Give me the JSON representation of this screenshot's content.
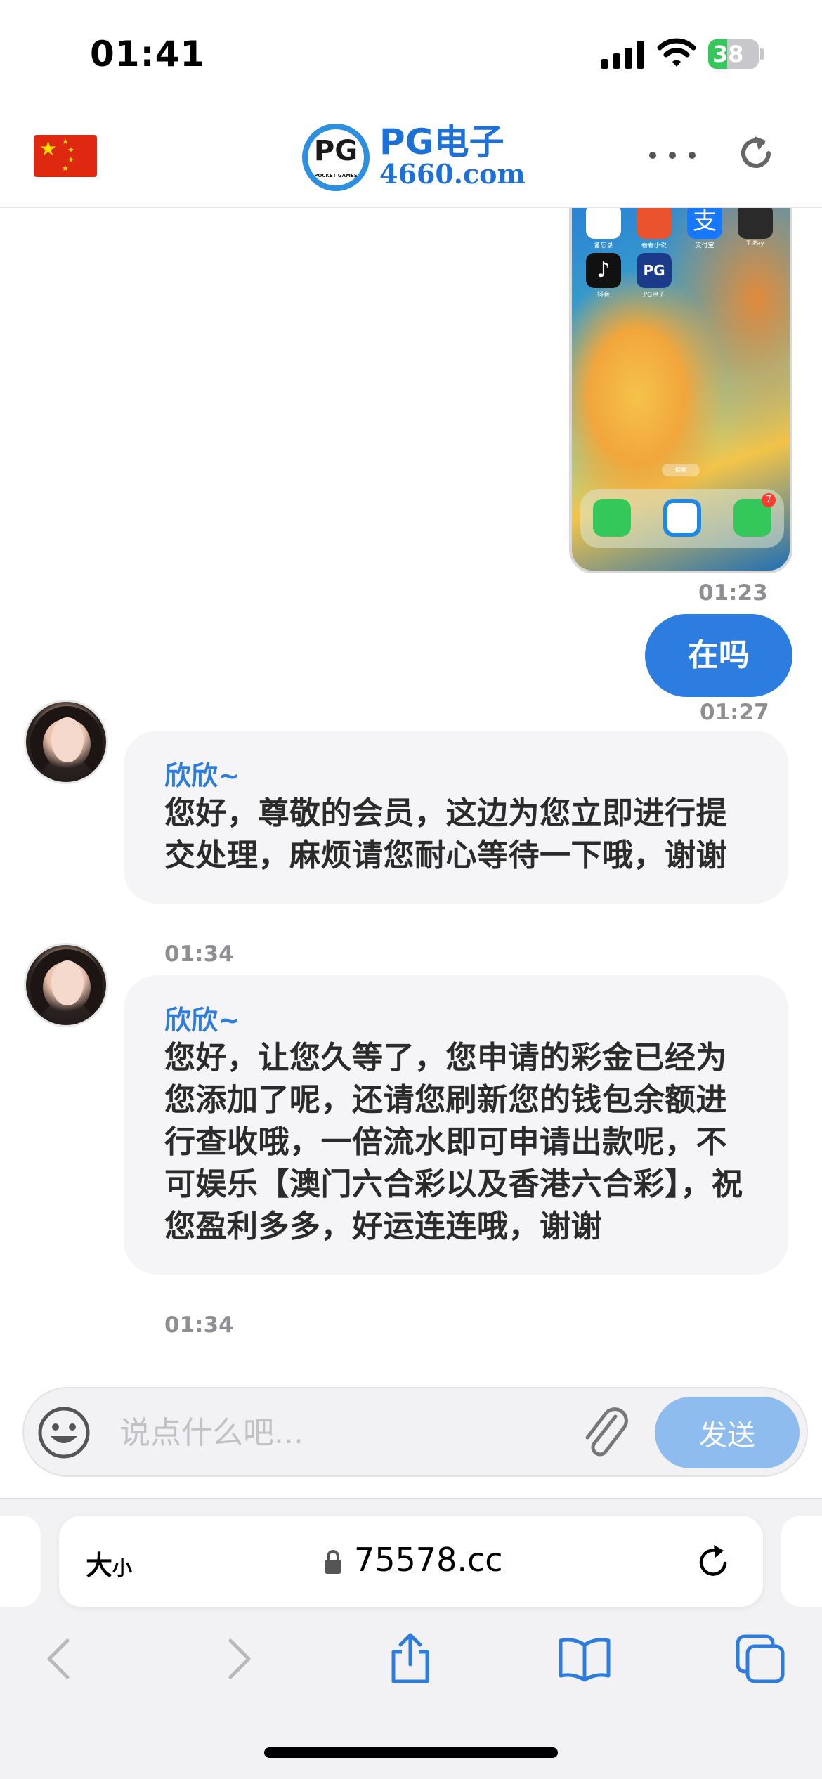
{
  "status_bar": {
    "time": "01:41",
    "battery_percent": "38",
    "battery_level": 0.38
  },
  "header": {
    "logo_badge": "PG",
    "logo_badge_sub": "POCKET GAMES",
    "logo_title": "PG电子",
    "logo_url": "4660.com"
  },
  "shared_screenshot": {
    "apps": [
      "备忘录",
      "看看小说",
      "支付宝",
      "ToPay",
      "抖音",
      "PG电子"
    ],
    "search_label": "搜索",
    "badge_count": "7",
    "time": "01:23"
  },
  "messages": [
    {
      "direction": "out",
      "text": "在吗",
      "time": "01:27"
    },
    {
      "direction": "in",
      "sender": "欣欣~",
      "text": "您好，尊敬的会员，这边为您立即进行提交处理，麻烦请您耐心等待一下哦，谢谢",
      "time": "01:34"
    },
    {
      "direction": "in",
      "sender": "欣欣~",
      "text": "您好，让您久等了，您申请的彩金已经为您添加了呢，还请您刷新您的钱包余额进行查收哦，一倍流水即可申请出款呢，不可娱乐【澳门六合彩以及香港六合彩】，祝您盈利多多，好运连连哦，谢谢",
      "time": "01:34"
    }
  ],
  "composer": {
    "placeholder": "说点什么吧...",
    "value": "",
    "send_label": "发送"
  },
  "browser": {
    "aa_big": "大",
    "aa_small": "小",
    "url": "75578.cc"
  },
  "colors": {
    "accent": "#2d7ce0",
    "send_disabled": "#8fbcee",
    "bubble_in": "#f5f5f7"
  }
}
